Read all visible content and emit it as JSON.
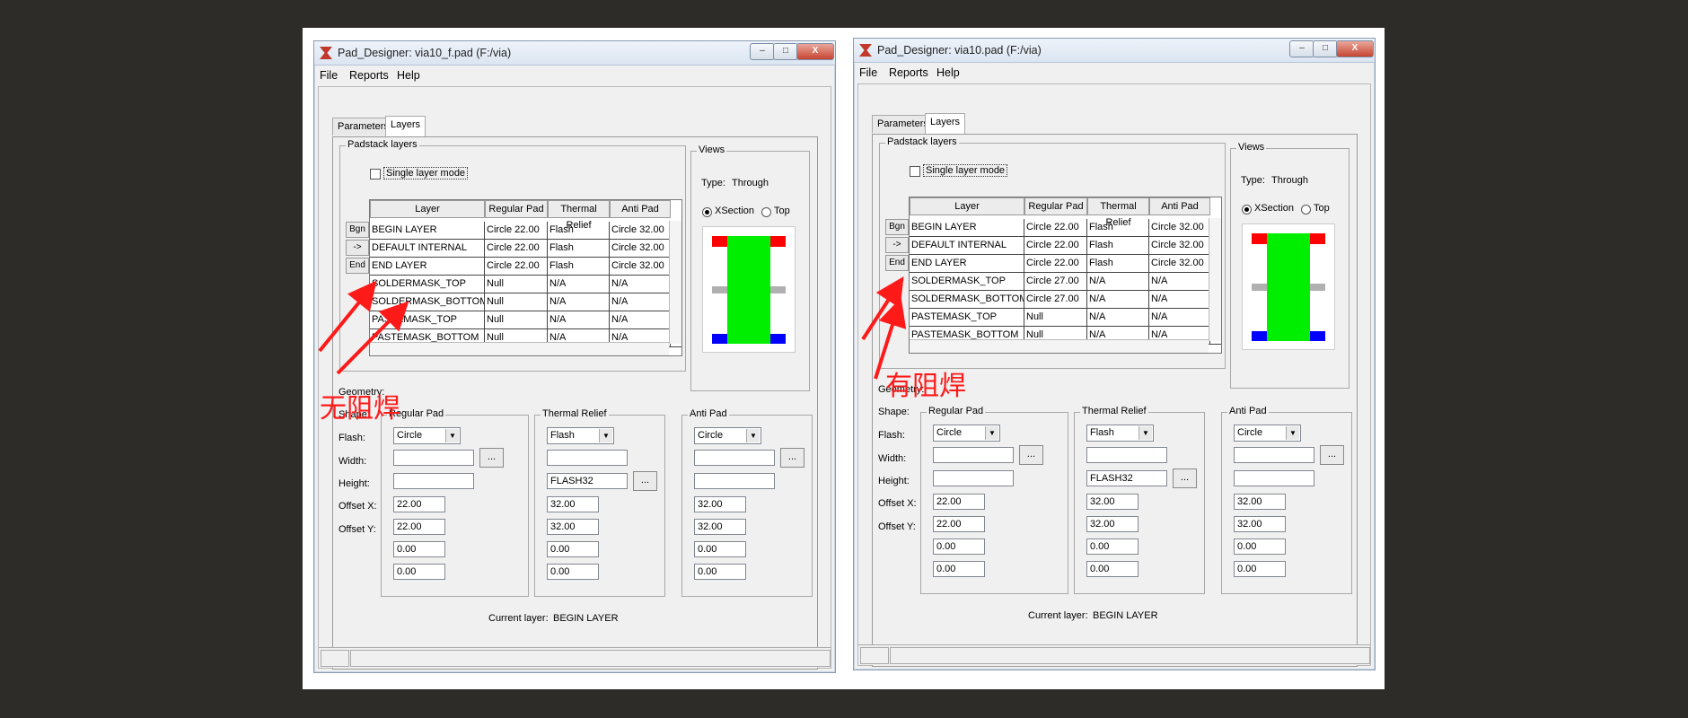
{
  "windows": [
    {
      "title": "Pad_Designer: via10_f.pad (F:/via)",
      "menu": [
        "File",
        "Reports",
        "Help"
      ],
      "tabs": [
        "Parameters",
        "Layers"
      ],
      "padstack_label": "Padstack layers",
      "single_layer_mode": "Single layer mode",
      "columns": [
        "Layer",
        "Regular Pad",
        "Thermal Relief",
        "Anti Pad"
      ],
      "row_buttons": [
        "Bgn",
        "->",
        "End"
      ],
      "rows": [
        [
          "BEGIN LAYER",
          "Circle 22.00",
          "Flash",
          "Circle 32.00"
        ],
        [
          "DEFAULT INTERNAL",
          "Circle 22.00",
          "Flash",
          "Circle 32.00"
        ],
        [
          "END LAYER",
          "Circle 22.00",
          "Flash",
          "Circle 32.00"
        ],
        [
          "SOLDERMASK_TOP",
          "Null",
          "N/A",
          "N/A"
        ],
        [
          "SOLDERMASK_BOTTOM",
          "Null",
          "N/A",
          "N/A"
        ],
        [
          "PASTEMASK_TOP",
          "Null",
          "N/A",
          "N/A"
        ],
        [
          "PASTEMASK_BOTTOM",
          "Null",
          "N/A",
          "N/A"
        ]
      ],
      "views": {
        "label": "Views",
        "type_label": "Type:",
        "type_value": "Through",
        "xsection": "XSection",
        "top": "Top"
      },
      "field_labels": [
        "Geometry:",
        "Shape:",
        "Flash:",
        "Width:",
        "Height:",
        "Offset X:",
        "Offset Y:"
      ],
      "regular_pad": {
        "label": "Regular Pad",
        "geometry": "Circle",
        "flash": "",
        "width": "22.00",
        "height": "22.00",
        "offset_x": "0.00",
        "offset_y": "0.00"
      },
      "thermal_relief": {
        "label": "Thermal Relief",
        "geometry": "Flash",
        "flash": "FLASH32",
        "width": "32.00",
        "height": "32.00",
        "offset_x": "0.00",
        "offset_y": "0.00"
      },
      "anti_pad": {
        "label": "Anti Pad",
        "geometry": "Circle",
        "flash": "",
        "width": "32.00",
        "height": "32.00",
        "offset_x": "0.00",
        "offset_y": "0.00"
      },
      "dots": "...",
      "current_layer_label": "Current layer:",
      "current_layer_value": "BEGIN LAYER",
      "annotation": "无阻焊"
    },
    {
      "title": "Pad_Designer: via10.pad (F:/via)",
      "menu": [
        "File",
        "Reports",
        "Help"
      ],
      "tabs": [
        "Parameters",
        "Layers"
      ],
      "padstack_label": "Padstack layers",
      "single_layer_mode": "Single layer mode",
      "columns": [
        "Layer",
        "Regular Pad",
        "Thermal Relief",
        "Anti Pad"
      ],
      "row_buttons": [
        "Bgn",
        "->",
        "End"
      ],
      "rows": [
        [
          "BEGIN LAYER",
          "Circle 22.00",
          "Flash",
          "Circle 32.00"
        ],
        [
          "DEFAULT INTERNAL",
          "Circle 22.00",
          "Flash",
          "Circle 32.00"
        ],
        [
          "END LAYER",
          "Circle 22.00",
          "Flash",
          "Circle 32.00"
        ],
        [
          "SOLDERMASK_TOP",
          "Circle 27.00",
          "N/A",
          "N/A"
        ],
        [
          "SOLDERMASK_BOTTOM",
          "Circle 27.00",
          "N/A",
          "N/A"
        ],
        [
          "PASTEMASK_TOP",
          "Null",
          "N/A",
          "N/A"
        ],
        [
          "PASTEMASK_BOTTOM",
          "Null",
          "N/A",
          "N/A"
        ]
      ],
      "views": {
        "label": "Views",
        "type_label": "Type:",
        "type_value": "Through",
        "xsection": "XSection",
        "top": "Top"
      },
      "field_labels": [
        "Geometry:",
        "Shape:",
        "Flash:",
        "Width:",
        "Height:",
        "Offset X:",
        "Offset Y:"
      ],
      "regular_pad": {
        "label": "Regular Pad",
        "geometry": "Circle",
        "flash": "",
        "width": "22.00",
        "height": "22.00",
        "offset_x": "0.00",
        "offset_y": "0.00"
      },
      "thermal_relief": {
        "label": "Thermal Relief",
        "geometry": "Flash",
        "flash": "FLASH32",
        "width": "32.00",
        "height": "32.00",
        "offset_x": "0.00",
        "offset_y": "0.00"
      },
      "anti_pad": {
        "label": "Anti Pad",
        "geometry": "Circle",
        "flash": "",
        "width": "32.00",
        "height": "32.00",
        "offset_x": "0.00",
        "offset_y": "0.00"
      },
      "dots": "...",
      "current_layer_label": "Current layer:",
      "current_layer_value": "BEGIN LAYER",
      "annotation": "有阻焊"
    }
  ],
  "colors": {
    "background": "#2e2c28",
    "annotation": "#ff1a1a",
    "pad_top": "#ff0000",
    "barrel": "#00ee00",
    "internal": "#b0b0b0",
    "pad_bottom": "#0000ff"
  }
}
